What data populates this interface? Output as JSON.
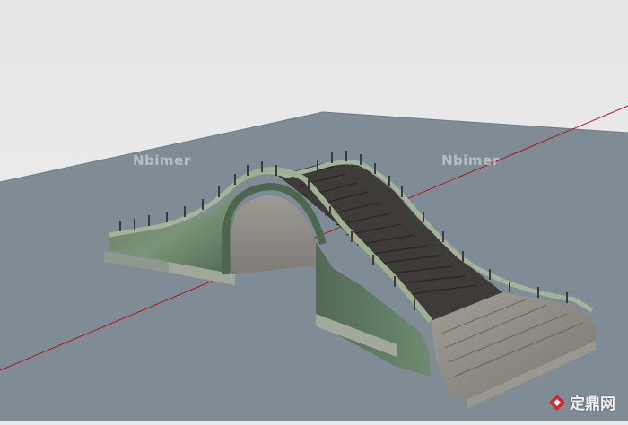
{
  "scene": {
    "sky_color": "#e8e8e8",
    "ground_color": "#7f8c96",
    "axis_color": "#b01818",
    "stone_color": "#6f8a72",
    "deck_color": "#3e3b38",
    "steps_color": "#8d8a83"
  },
  "watermarks": {
    "left": "Nbimer",
    "right": "Nbimer"
  },
  "brand": {
    "name": "定鼎网",
    "logo_icon": "red-diamond-logo-icon"
  }
}
